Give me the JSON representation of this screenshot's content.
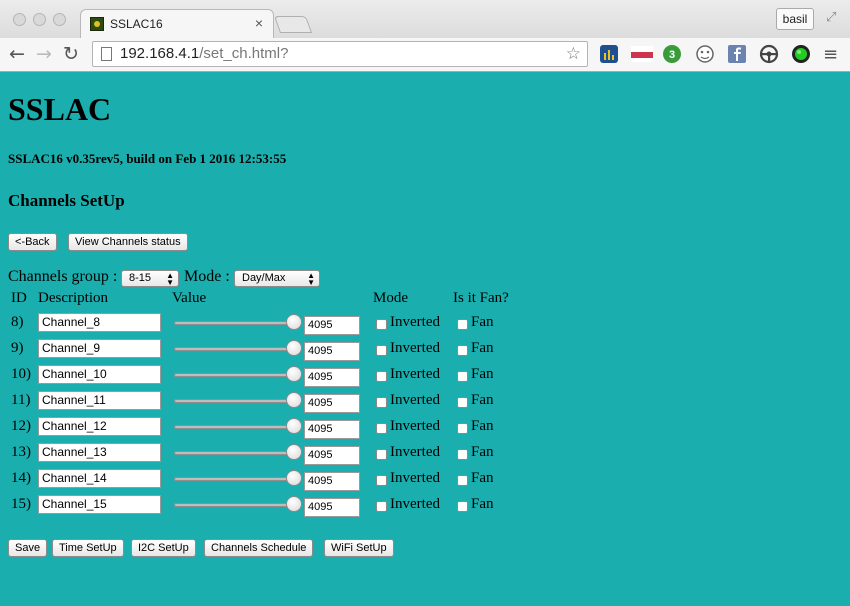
{
  "browser": {
    "tab_title": "SSLAC16",
    "tab_close": "×",
    "profile_name": "basil",
    "url_host": "192.168.4.1",
    "url_path": "/set_ch.html?",
    "icons": {
      "back": "←",
      "forward": "→",
      "reload": "↻",
      "star": "☆",
      "menu": "≡",
      "fullscreen": "⤢"
    },
    "extensions": [
      {
        "name": "chart-extension-icon",
        "color": "#1e4f8f"
      },
      {
        "name": "javaee-extension-icon",
        "color": "#c8102e"
      },
      {
        "name": "counter-extension-icon",
        "color": "#3a9b3a",
        "badge": "3"
      },
      {
        "name": "face-extension-icon",
        "color": "#666666"
      },
      {
        "name": "facebook-extension-icon",
        "color": "#6b83b0"
      },
      {
        "name": "steering-extension-icon",
        "color": "#444444"
      },
      {
        "name": "green-dot-extension-icon",
        "color": "#22aa22"
      }
    ]
  },
  "page": {
    "title": "SSLAC",
    "build_info": "SSLAC16 v0.35rev5, build on Feb 1 2016 12:53:55",
    "section_title": "Channels SetUp",
    "back_button": "<-Back",
    "view_status_button": "View Channels status",
    "group_label": "Channels group :",
    "group_value": "8-15",
    "mode_label": "Mode :",
    "mode_value": "Day/Max",
    "columns": {
      "id": "ID",
      "description": "Description",
      "value": "Value",
      "mode": "Mode",
      "fan": "Is it Fan?"
    },
    "checkbox_inverted": "Inverted",
    "checkbox_fan": "Fan",
    "slider_level": 1.0,
    "channels": [
      {
        "id": "8)",
        "description": "Channel_8",
        "value": "4095"
      },
      {
        "id": "9)",
        "description": "Channel_9",
        "value": "4095"
      },
      {
        "id": "10)",
        "description": "Channel_10",
        "value": "4095"
      },
      {
        "id": "11)",
        "description": "Channel_11",
        "value": "4095"
      },
      {
        "id": "12)",
        "description": "Channel_12",
        "value": "4095"
      },
      {
        "id": "13)",
        "description": "Channel_13",
        "value": "4095"
      },
      {
        "id": "14)",
        "description": "Channel_14",
        "value": "4095"
      },
      {
        "id": "15)",
        "description": "Channel_15",
        "value": "4095"
      }
    ],
    "bottom_buttons": {
      "save": "Save",
      "time_setup": "Time SetUp",
      "i2c_setup": "I2C SetUp",
      "channels_schedule": "Channels Schedule",
      "wifi_setup": "WiFi SetUp"
    }
  },
  "colors": {
    "page_background": "#1aafae"
  }
}
